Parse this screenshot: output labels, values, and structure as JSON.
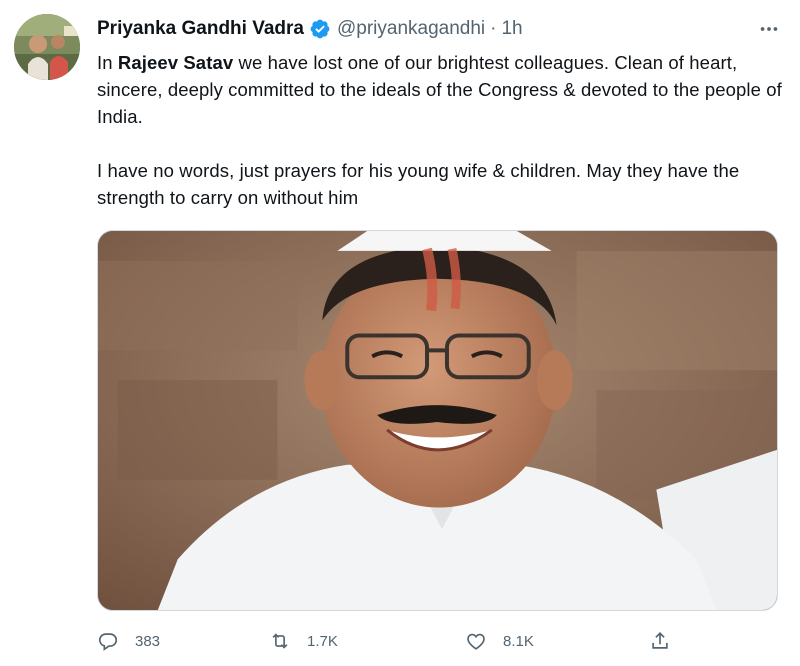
{
  "author": {
    "display_name": "Priyanka Gandhi Vadra",
    "handle": "@priyankagandhi",
    "separator": "·",
    "time": "1h",
    "verified_icon": "verified-badge-icon"
  },
  "tweet": {
    "p1_before": "In ",
    "p1_mention": "Rajeev Satav",
    "p1_after": " we have lost one of our brightest colleagues. Clean of heart, sincere, deeply committed to the ideals of the Congress & devoted to the people of India.",
    "p2": "I have no words, just prayers for his young wife & children. May they have the strength to carry on without him"
  },
  "actions": {
    "reply_count": "383",
    "retweet_count": "1.7K",
    "like_count": "8.1K"
  },
  "colors": {
    "text": "#0f1419",
    "secondary": "#536471",
    "verified": "#1d9bf0"
  }
}
